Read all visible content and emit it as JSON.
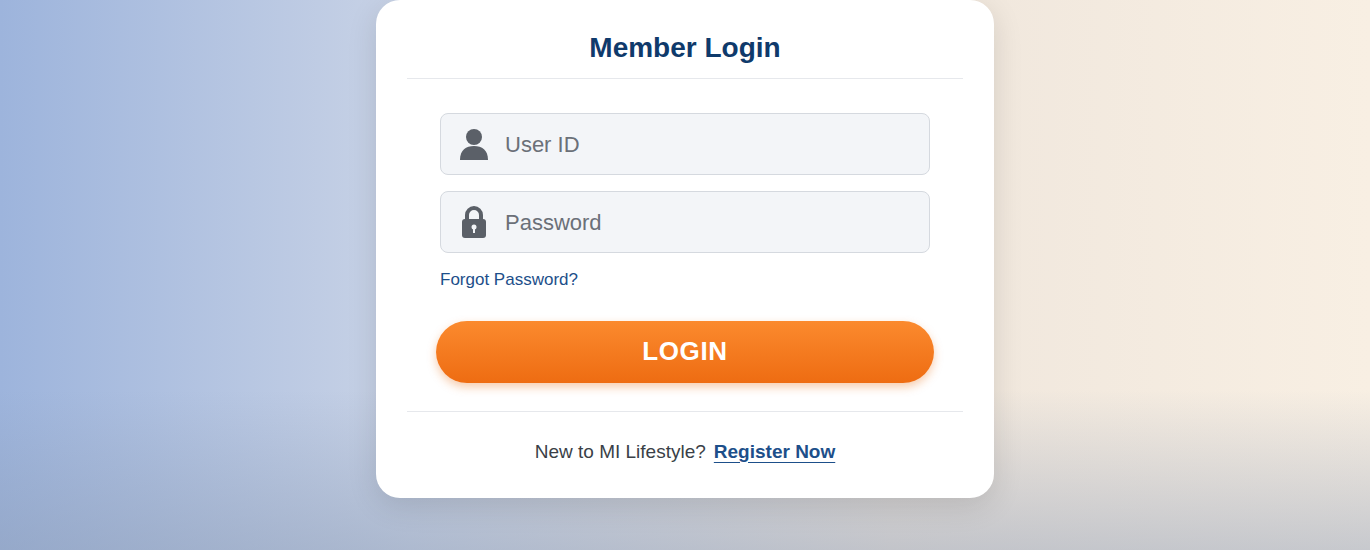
{
  "login_card": {
    "title": "Member Login",
    "user_id": {
      "placeholder": "User ID"
    },
    "password": {
      "placeholder": "Password"
    },
    "forgot_link": "Forgot Password?",
    "login_button": "LOGIN",
    "register_prompt": "New to MI Lifestyle?",
    "register_link": "Register Now"
  }
}
